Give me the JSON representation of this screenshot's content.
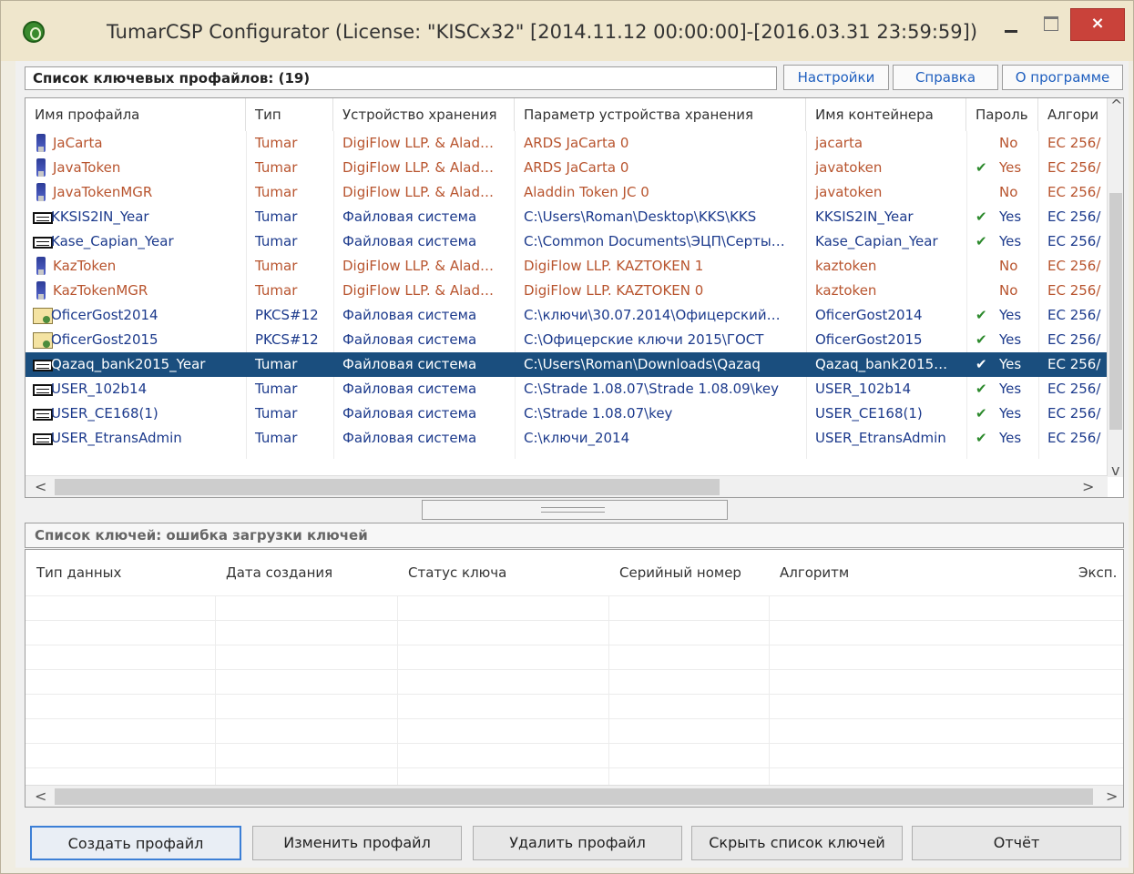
{
  "window": {
    "title": "TumarCSP Configurator (License: \"KISCx32\" [2014.11.12 00:00:00]-[2016.03.31 23:59:59])",
    "close_glyph": "×"
  },
  "toolbar": {
    "profiles_label": "Список ключевых профайлов: (19)",
    "settings": "Настройки",
    "help": "Справка",
    "about": "О программе"
  },
  "profiles": {
    "columns": [
      "Имя профайла",
      "Тип",
      "Устройство хранения",
      "Параметр устройства хранения",
      "Имя контейнера",
      "Пароль",
      "Алгори"
    ],
    "rows": [
      {
        "name": "JaCarta",
        "type": "Tumar",
        "device": "DigiFlow LLP. & Alad…",
        "param": "ARDS JaCarta 0",
        "container": "jacarta",
        "password_check": false,
        "password": "No",
        "algo": "EC 256/",
        "icon": "token-icon",
        "style": "red"
      },
      {
        "name": "JavaToken",
        "type": "Tumar",
        "device": "DigiFlow LLP. & Alad…",
        "param": "ARDS JaCarta 0",
        "container": "javatoken",
        "password_check": true,
        "password": "Yes",
        "algo": "EC 256/",
        "icon": "token-icon",
        "style": "red"
      },
      {
        "name": "JavaTokenMGR",
        "type": "Tumar",
        "device": "DigiFlow LLP. & Alad…",
        "param": "Aladdin Token JC 0",
        "container": "javatoken",
        "password_check": false,
        "password": "No",
        "algo": "EC 256/",
        "icon": "token-icon",
        "style": "red"
      },
      {
        "name": "KKSIS2IN_Year",
        "type": "Tumar",
        "device": "Файловая система",
        "param": "C:\\Users\\Roman\\Desktop\\KKS\\KKS",
        "container": "KKSIS2IN_Year",
        "password_check": true,
        "password": "Yes",
        "algo": "EC 256/",
        "icon": "file-storage-icon",
        "style": "blue"
      },
      {
        "name": "Kase_Capian_Year",
        "type": "Tumar",
        "device": "Файловая система",
        "param": "C:\\Common Documents\\ЭЦП\\Серты…",
        "container": "Kase_Capian_Year",
        "password_check": true,
        "password": "Yes",
        "algo": "EC 256/",
        "icon": "file-storage-icon",
        "style": "blue"
      },
      {
        "name": "KazToken",
        "type": "Tumar",
        "device": "DigiFlow LLP. & Alad…",
        "param": "DigiFlow LLP. KAZTOKEN 1",
        "container": "kaztoken",
        "password_check": false,
        "password": "No",
        "algo": "EC 256/",
        "icon": "token-icon",
        "style": "red"
      },
      {
        "name": "KazTokenMGR",
        "type": "Tumar",
        "device": "DigiFlow LLP. & Alad…",
        "param": "DigiFlow LLP. KAZTOKEN 0",
        "container": "kaztoken",
        "password_check": false,
        "password": "No",
        "algo": "EC 256/",
        "icon": "token-icon",
        "style": "red"
      },
      {
        "name": "OficerGost2014",
        "type": "PKCS#12",
        "device": "Файловая система",
        "param": "C:\\ключи\\30.07.2014\\Офицерский…",
        "container": "OficerGost2014",
        "password_check": true,
        "password": "Yes",
        "algo": "EC 256/",
        "icon": "certificate-icon",
        "style": "blue"
      },
      {
        "name": "OficerGost2015",
        "type": "PKCS#12",
        "device": "Файловая система",
        "param": "C:\\Офицерские ключи 2015\\ГОСТ",
        "container": "OficerGost2015",
        "password_check": true,
        "password": "Yes",
        "algo": "EC 256/",
        "icon": "certificate-icon",
        "style": "blue"
      },
      {
        "name": "Qazaq_bank2015_Year",
        "type": "Tumar",
        "device": "Файловая система",
        "param": "C:\\Users\\Roman\\Downloads\\Qazaq",
        "container": "Qazaq_bank2015…",
        "password_check": true,
        "password": "Yes",
        "algo": "EC 256/",
        "icon": "file-storage-icon",
        "style": "blue",
        "selected": true
      },
      {
        "name": "USER_102b14",
        "type": "Tumar",
        "device": "Файловая система",
        "param": "C:\\Strade 1.08.07\\Strade 1.08.09\\key",
        "container": "USER_102b14",
        "password_check": true,
        "password": "Yes",
        "algo": "EC 256/",
        "icon": "file-storage-icon",
        "style": "blue"
      },
      {
        "name": "USER_CE168(1)",
        "type": "Tumar",
        "device": "Файловая система",
        "param": "C:\\Strade 1.08.07\\key",
        "container": "USER_CE168(1)",
        "password_check": true,
        "password": "Yes",
        "algo": "EC 256/",
        "icon": "file-storage-icon",
        "style": "blue"
      },
      {
        "name": "USER_EtransAdmin",
        "type": "Tumar",
        "device": "Файловая система",
        "param": "C:\\ключи_2014",
        "container": "USER_EtransAdmin",
        "password_check": true,
        "password": "Yes",
        "algo": "EC 256/",
        "icon": "file-storage-icon",
        "style": "blue"
      }
    ]
  },
  "keys": {
    "label": "Список ключей: ошибка загрузки ключей",
    "columns": [
      "Тип данных",
      "Дата создания",
      "Статус ключа",
      "Серийный номер",
      "Алгоритм",
      "Эксп."
    ]
  },
  "buttons": {
    "create": "Создать профайл",
    "edit": "Изменить профайл",
    "delete": "Удалить профайл",
    "hide_keys": "Скрыть список ключей",
    "report": "Отчёт"
  },
  "glyphs": {
    "left": "<",
    "right": ">",
    "up": "^",
    "down": "v",
    "check": "✔"
  },
  "colors": {
    "selection": "#1a4e7e",
    "token_text": "#b8542e",
    "file_text": "#1c3a8c",
    "check": "#2d8a2d",
    "close_button": "#c9423a"
  }
}
